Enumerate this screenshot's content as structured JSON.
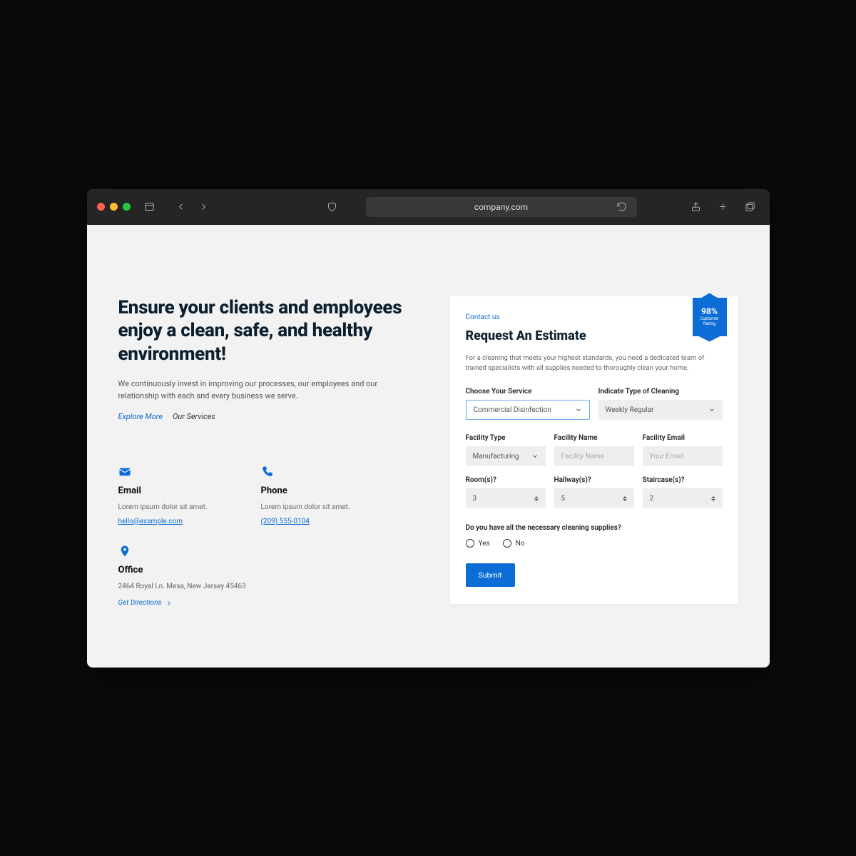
{
  "browser": {
    "url": "company.com"
  },
  "hero": {
    "headline": "Ensure your clients and employees enjoy a clean, safe, and healthy environment!",
    "subtext": "We continuously invest in improving our processes, our employees and our relationship with each and every business we serve.",
    "explore_more": "Explore More",
    "our_services": "Our Services"
  },
  "contact": {
    "email": {
      "title": "Email",
      "desc": "Lorem ipsum dolor sit amet.",
      "link": "hello@example.com"
    },
    "phone": {
      "title": "Phone",
      "desc": "Lorem ipsum dolor sit amet.",
      "link": "(209) 555-0104"
    },
    "office": {
      "title": "Office",
      "address": "2464 Royal Ln. Mesa, New Jersey 45463",
      "directions": "Get Directions"
    }
  },
  "form": {
    "eyebrow": "Contact us",
    "title": "Request An Estimate",
    "desc": "For a cleaning that meets your highest standards, you need a dedicated team of trained specialists with all supplies needed to thoroughly clean your home.",
    "badge": {
      "value": "98%",
      "label_1": "Customer",
      "label_2": "Rating"
    },
    "service_label": "Choose Your Service",
    "service_value": "Commercial Disinfection",
    "cleaning_type_label": "Indicate Type of Cleaning",
    "cleaning_type_value": "Weekly Regular",
    "facility_type_label": "Facility Type",
    "facility_type_value": "Manufacturing",
    "facility_name_label": "Facility Name",
    "facility_name_placeholder": "Facility Name",
    "facility_email_label": "Facility Email",
    "facility_email_placeholder": "Your Email",
    "rooms_label": "Room(s)?",
    "rooms_value": "3",
    "hallways_label": "Hallway(s)?",
    "hallways_value": "5",
    "staircases_label": "Staircase(s)?",
    "staircases_value": "2",
    "supplies_question": "Do you have all the necessary cleaning supplies?",
    "yes": "Yes",
    "no": "No",
    "submit": "Submit"
  }
}
